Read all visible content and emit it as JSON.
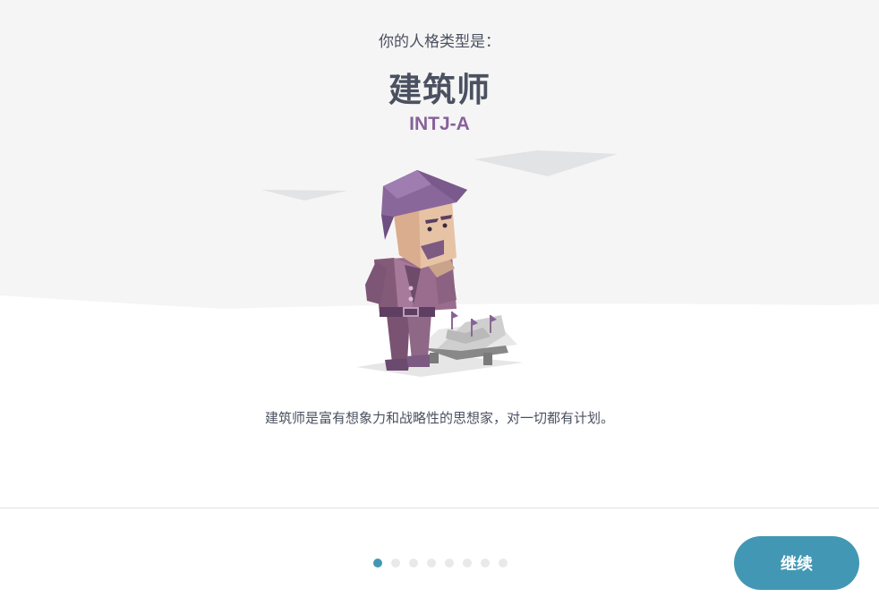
{
  "result": {
    "subtitle": "你的人格类型是：",
    "type_name": "建筑师",
    "type_code": "INTJ-A",
    "description": "建筑师是富有想象力和战略性的思想家，对一切都有计划。"
  },
  "illustration": {
    "subject": "architect-character"
  },
  "pager": {
    "total": 8,
    "current": 1
  },
  "actions": {
    "continue_label": "继续"
  },
  "colors": {
    "accent": "#4298b4",
    "type_code": "#88619a",
    "text": "#4b5160",
    "hero_bg": "#f5f5f5",
    "dot_inactive": "#e8e9eb"
  }
}
